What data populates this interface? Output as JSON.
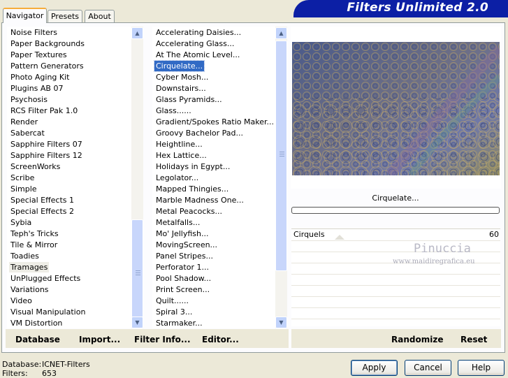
{
  "tabs": [
    {
      "label": "Navigator",
      "active": true
    },
    {
      "label": "Presets",
      "active": false
    },
    {
      "label": "About",
      "active": false
    }
  ],
  "app_title": "Filters Unlimited 2.0",
  "categories": {
    "items": [
      "Noise Filters",
      "Paper Backgrounds",
      "Paper Textures",
      "Pattern Generators",
      "Photo Aging Kit",
      "Plugins AB 07",
      "Psychosis",
      "RCS Filter Pak 1.0",
      "Render",
      "Sabercat",
      "Sapphire Filters 07",
      "Sapphire Filters 12",
      "ScreenWorks",
      "Scribe",
      "Simple",
      "Special Effects 1",
      "Special Effects 2",
      "Sybia",
      "Teph's Tricks",
      "Tile & Mirror",
      "Toadies",
      "Tramages",
      "UnPlugged Effects",
      "Variations",
      "Video",
      "Visual Manipulation",
      "VM Distortion"
    ],
    "selected": "Tramages"
  },
  "filters": {
    "items": [
      "Accelerating Daisies...",
      "Accelerating Glass...",
      "At The Atomic Level...",
      "Cirquelate...",
      "Cyber Mosh...",
      "Downstairs...",
      "Glass Pyramids...",
      "Glass......",
      "Gradient/Spokes Ratio Maker...",
      "Groovy Bachelor Pad...",
      "Heightline...",
      "Hex Lattice...",
      "Holidays in Egypt...",
      "Legolator...",
      "Mapped Thingies...",
      "Marble Madness One...",
      "Metal Peacocks...",
      "Metalfalls...",
      "Mo' Jellyfish...",
      "MovingScreen...",
      "Panel Stripes...",
      "Perforator 1...",
      "Pool Shadow...",
      "Print Screen...",
      "Quilt......",
      "Spiral 3...",
      "Starmaker..."
    ],
    "selected": "Cirquelate..."
  },
  "preview": {
    "filter_name": "Cirquelate...",
    "progress": 0
  },
  "params": [
    {
      "name": "Cirquels",
      "value": "60"
    }
  ],
  "watermark": {
    "name": "Pinuccia",
    "site": "www.maidiregrafica.eu"
  },
  "toolbar": {
    "database": "Database",
    "import": "Import...",
    "filter_info": "Filter Info...",
    "editor": "Editor...",
    "randomize": "Randomize",
    "reset": "Reset"
  },
  "status": {
    "database_label": "Database:",
    "database_value": "ICNET-Filters",
    "filters_label": "Filters:",
    "filters_value": "653"
  },
  "buttons": {
    "apply": "Apply",
    "cancel": "Cancel",
    "help": "Help"
  },
  "colors": {
    "banner": "#0c1fa5",
    "selection": "#316ac5",
    "dialog_bg": "#ece9d8"
  }
}
